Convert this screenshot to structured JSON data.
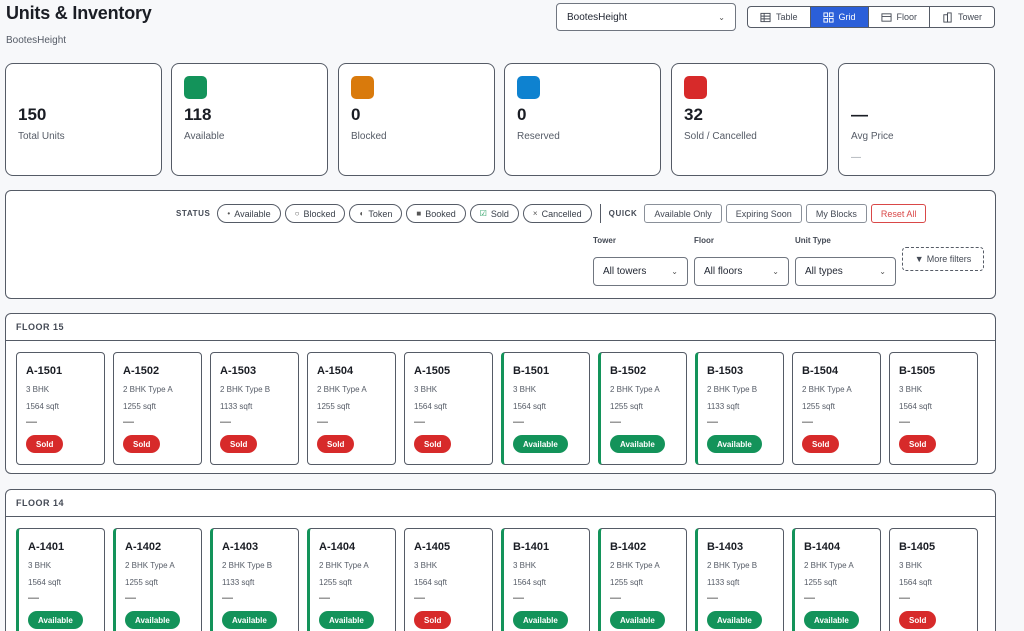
{
  "header": {
    "title": "Units & Inventory",
    "subtitle": "BootesHeight"
  },
  "project_select": {
    "value": "BootesHeight"
  },
  "view_tabs": [
    {
      "label": "Table",
      "icon": "table-icon"
    },
    {
      "label": "Grid",
      "icon": "grid-icon",
      "active": true
    },
    {
      "label": "Floor",
      "icon": "floor-icon"
    },
    {
      "label": "Tower",
      "icon": "tower-icon"
    }
  ],
  "stats": [
    {
      "value": "150",
      "label": "Total Units",
      "color": ""
    },
    {
      "value": "118",
      "label": "Available",
      "color": "#13935a"
    },
    {
      "value": "0",
      "label": "Blocked",
      "color": "#d97a0c"
    },
    {
      "value": "0",
      "label": "Reserved",
      "color": "#0e82d0"
    },
    {
      "value": "32",
      "label": "Sold / Cancelled",
      "color": "#d72a2a"
    },
    {
      "value": "—",
      "label": "Avg Price",
      "sub": "—",
      "color": ""
    }
  ],
  "filters": {
    "status_label": "STATUS",
    "status_chips": [
      {
        "label": "Available",
        "icon": "dot-icon",
        "glyph": "•"
      },
      {
        "label": "Blocked",
        "icon": "circle-icon",
        "glyph": "○"
      },
      {
        "label": "Token",
        "icon": "half-circle-icon",
        "glyph": "◐"
      },
      {
        "label": "Booked",
        "icon": "square-icon",
        "glyph": "■"
      },
      {
        "label": "Sold",
        "icon": "checkbox-icon",
        "glyph": "☑"
      },
      {
        "label": "Cancelled",
        "icon": "x-icon",
        "glyph": "×"
      }
    ],
    "quick_label": "QUICK",
    "quick_buttons": [
      "Available Only",
      "Expiring Soon",
      "My Blocks"
    ],
    "reset_label": "Reset All",
    "tower": {
      "label": "Tower",
      "value": "All towers"
    },
    "floor": {
      "label": "Floor",
      "value": "All floors"
    },
    "unit_type": {
      "label": "Unit Type",
      "value": "All types"
    },
    "more_filters": "More filters"
  },
  "floors": [
    {
      "label": "FLOOR 15",
      "units": [
        {
          "code": "A-1501",
          "type": "3 BHK",
          "area": "1564 sqft",
          "price": "—",
          "status": "Sold"
        },
        {
          "code": "A-1502",
          "type": "2 BHK Type A",
          "area": "1255 sqft",
          "price": "—",
          "status": "Sold"
        },
        {
          "code": "A-1503",
          "type": "2 BHK Type B",
          "area": "1133 sqft",
          "price": "—",
          "status": "Sold"
        },
        {
          "code": "A-1504",
          "type": "2 BHK Type A",
          "area": "1255 sqft",
          "price": "—",
          "status": "Sold"
        },
        {
          "code": "A-1505",
          "type": "3 BHK",
          "area": "1564 sqft",
          "price": "—",
          "status": "Sold"
        },
        {
          "code": "B-1501",
          "type": "3 BHK",
          "area": "1564 sqft",
          "price": "—",
          "status": "Available"
        },
        {
          "code": "B-1502",
          "type": "2 BHK Type A",
          "area": "1255 sqft",
          "price": "—",
          "status": "Available"
        },
        {
          "code": "B-1503",
          "type": "2 BHK Type B",
          "area": "1133 sqft",
          "price": "—",
          "status": "Available"
        },
        {
          "code": "B-1504",
          "type": "2 BHK Type A",
          "area": "1255 sqft",
          "price": "—",
          "status": "Sold"
        },
        {
          "code": "B-1505",
          "type": "3 BHK",
          "area": "1564 sqft",
          "price": "—",
          "status": "Sold"
        }
      ]
    },
    {
      "label": "FLOOR 14",
      "units": [
        {
          "code": "A-1401",
          "type": "3 BHK",
          "area": "1564 sqft",
          "price": "—",
          "status": "Available"
        },
        {
          "code": "A-1402",
          "type": "2 BHK Type A",
          "area": "1255 sqft",
          "price": "—",
          "status": "Available"
        },
        {
          "code": "A-1403",
          "type": "2 BHK Type B",
          "area": "1133 sqft",
          "price": "—",
          "status": "Available"
        },
        {
          "code": "A-1404",
          "type": "2 BHK Type A",
          "area": "1255 sqft",
          "price": "—",
          "status": "Available"
        },
        {
          "code": "A-1405",
          "type": "3 BHK",
          "area": "1564 sqft",
          "price": "—",
          "status": "Sold"
        },
        {
          "code": "B-1401",
          "type": "3 BHK",
          "area": "1564 sqft",
          "price": "—",
          "status": "Available"
        },
        {
          "code": "B-1402",
          "type": "2 BHK Type A",
          "area": "1255 sqft",
          "price": "—",
          "status": "Available"
        },
        {
          "code": "B-1403",
          "type": "2 BHK Type B",
          "area": "1133 sqft",
          "price": "—",
          "status": "Available"
        },
        {
          "code": "B-1404",
          "type": "2 BHK Type A",
          "area": "1255 sqft",
          "price": "—",
          "status": "Available"
        },
        {
          "code": "B-1405",
          "type": "3 BHK",
          "area": "1564 sqft",
          "price": "—",
          "status": "Sold"
        }
      ]
    }
  ]
}
